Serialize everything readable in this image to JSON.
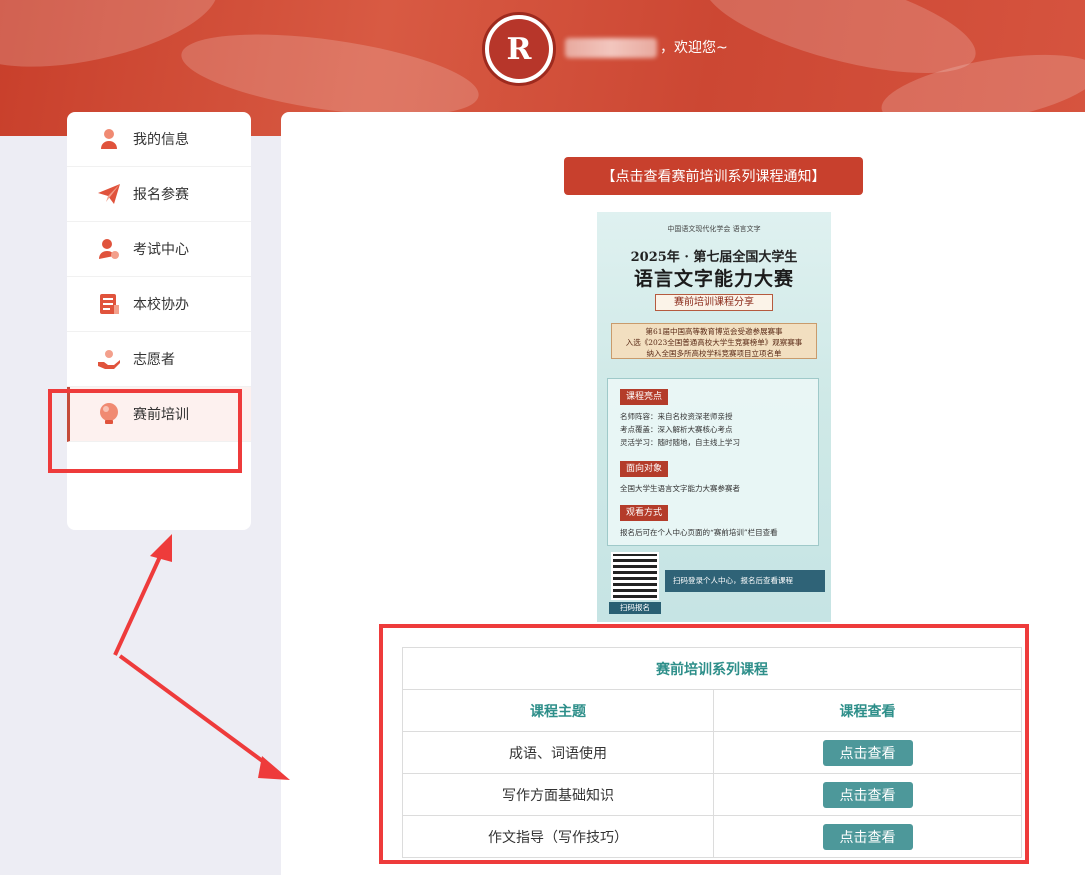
{
  "header": {
    "welcome": "，欢迎您~",
    "logo_text": "R"
  },
  "sidebar": {
    "items": [
      {
        "label": "我的信息",
        "icon": "user-icon"
      },
      {
        "label": "报名参赛",
        "icon": "paper-plane-icon"
      },
      {
        "label": "考试中心",
        "icon": "exam-user-icon"
      },
      {
        "label": "本校协办",
        "icon": "document-icon"
      },
      {
        "label": "志愿者",
        "icon": "volunteer-hand-icon"
      },
      {
        "label": "赛前培训",
        "icon": "lightbulb-icon",
        "active": true
      }
    ]
  },
  "main": {
    "notice_button": "【点击查看赛前培训系列课程通知】",
    "poster": {
      "orgs": "中国语文现代化学会  语言文字",
      "year": "2025年 · 第七届全国大学生",
      "title": "语言文字能力大赛",
      "subtitle": "赛前培训课程分享",
      "scroll_lines": [
        "第61届中国高等教育博览会受邀参展赛事",
        "入选《2023全国普通高校大学生竞赛榜单》观察赛事",
        "纳入全国多所高校学科竞赛项目立项名单"
      ],
      "section1_tag": "课程亮点",
      "section1_lines": [
        "名师阵容：来自名校资深老师亲授",
        "考点覆盖：深入解析大赛核心考点",
        "灵活学习：随时随地，自主线上学习"
      ],
      "section2_tag": "面向对象",
      "section2_line": "全国大学生语言文字能力大赛参赛者",
      "section3_tag": "观看方式",
      "section3_line": "报名后可在个人中心页面的“赛前培训”栏目查看",
      "qr_label": "扫码报名",
      "scan_text": "扫码登录个人中心，报名后查看课程"
    },
    "table": {
      "title": "赛前培训系列课程",
      "col_topic": "课程主题",
      "col_view": "课程查看",
      "rows": [
        {
          "topic": "成语、词语使用",
          "button": "点击查看"
        },
        {
          "topic": "写作方面基础知识",
          "button": "点击查看"
        },
        {
          "topic": "作文指导（写作技巧）",
          "button": "点击查看"
        }
      ]
    }
  },
  "colors": {
    "brand_red": "#c8402d",
    "teal": "#2e8f8a",
    "button_teal": "#4d989a",
    "annotation_red": "#ee3b3b"
  }
}
